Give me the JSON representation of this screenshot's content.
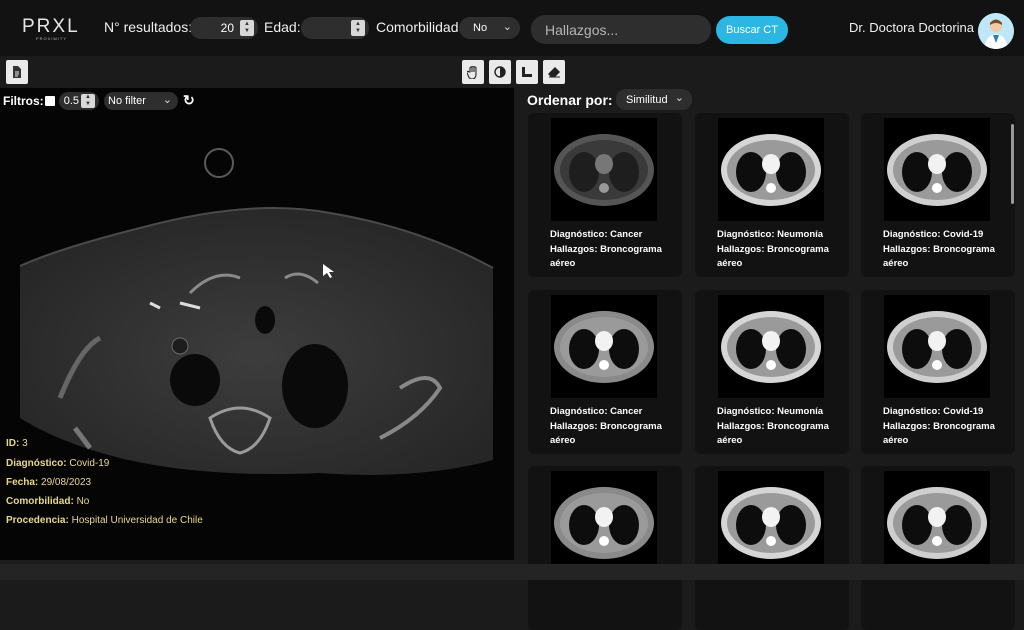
{
  "header": {
    "logo_text": "PRXL",
    "logo_sub": "PROXIMITY",
    "results_label": "N° resultados:",
    "results_value": "20",
    "age_label": "Edad:",
    "age_value": "",
    "comorbidity_label": "Comorbilidad",
    "comorbidity_value": "No",
    "search_placeholder": "Hallazgos...",
    "search_button": "Buscar CT",
    "user_name": "Dr. Doctora Doctorina"
  },
  "toolbar": {
    "left_tools": [
      "document-icon"
    ],
    "right_tools": [
      "hand-icon",
      "contrast-icon",
      "ruler-icon",
      "eraser-icon"
    ]
  },
  "filters": {
    "label": "Filtros:",
    "threshold": "0.5",
    "filter_select": "No filter"
  },
  "study": {
    "id_label": "ID:",
    "id_value": "3",
    "dx_label": "Diagnóstico:",
    "dx_value": "Covid-19",
    "date_label": "Fecha:",
    "date_value": "29/08/2023",
    "comorb_label": "Comorbilidad:",
    "comorb_value": "No",
    "source_label": "Procedencia:",
    "source_value": "Hospital Universidad de Chile"
  },
  "results": {
    "sort_label": "Ordenar por:",
    "sort_value": "Similitud",
    "cards": [
      {
        "dx": "Diagnóstico: Cancer",
        "finding": "Hallazgos: Broncograma aéreo"
      },
      {
        "dx": "Diagnóstico: Neumonía",
        "finding": "Hallazgos: Broncograma aéreo"
      },
      {
        "dx": "Diagnóstico: Covid-19",
        "finding": "Hallazgos: Broncograma aéreo"
      },
      {
        "dx": "Diagnóstico: Cancer",
        "finding": "Hallazgos: Broncograma aéreo"
      },
      {
        "dx": "Diagnóstico: Neumonía",
        "finding": "Hallazgos: Broncograma aéreo"
      },
      {
        "dx": "Diagnóstico: Covid-19",
        "finding": "Hallazgos: Broncograma aéreo"
      },
      {
        "dx": "",
        "finding": ""
      },
      {
        "dx": "",
        "finding": ""
      },
      {
        "dx": "",
        "finding": ""
      }
    ]
  },
  "colors": {
    "accent": "#2bb6e3",
    "info_text": "#e8d88a",
    "background": "#1b1b1b"
  }
}
